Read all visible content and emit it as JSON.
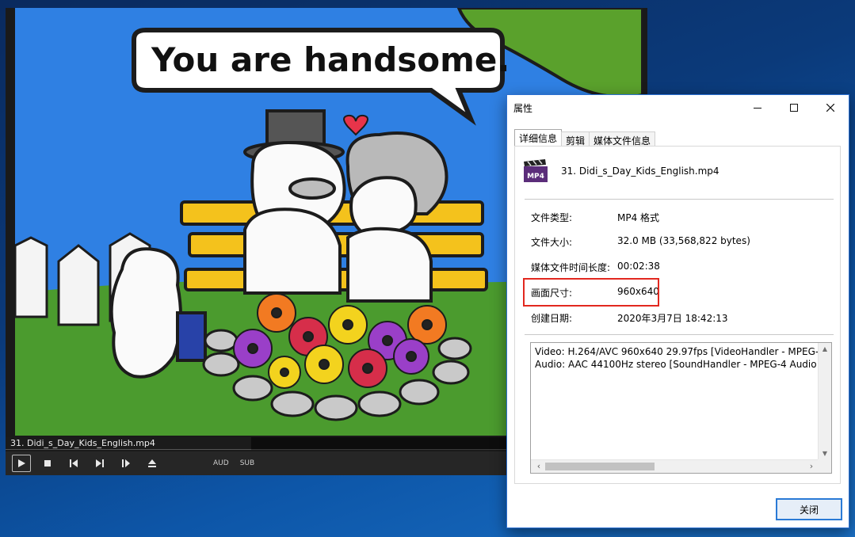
{
  "player": {
    "video_caption": "You are handsome.",
    "file_tab": "31. Didi_s_Day_Kids_English.mp4",
    "controls": {
      "aud_label": "AUD",
      "sub_label": "SUB"
    }
  },
  "dialog": {
    "title": "属性",
    "tabs": [
      "详细信息",
      "剪辑",
      "媒体文件信息"
    ],
    "active_tab": "详细信息",
    "file_icon_label": "MP4",
    "file_name": "31. Didi_s_Day_Kids_English.mp4",
    "properties": [
      {
        "label": "文件类型:",
        "value": "MP4 格式"
      },
      {
        "label": "文件大小:",
        "value": "32.0 MB (33,568,822 bytes)"
      },
      {
        "label": "媒体文件时间长度:",
        "value": "00:02:38"
      },
      {
        "label": "画面尺寸:",
        "value": "960x640"
      },
      {
        "label": "创建日期:",
        "value": "2020年3月7日 18:42:13"
      }
    ],
    "highlighted_row": "画面尺寸:",
    "highlight_color": "#e2281f",
    "stream_info": [
      "Video: H.264/AVC 960x640 29.97fps [VideoHandler - MPEG-",
      "Audio: AAC 44100Hz stereo [SoundHandler - MPEG-4 Audio"
    ],
    "close_button": "关闭"
  },
  "icons": {
    "minimize": "minimize-icon",
    "maximize": "maximize-icon",
    "close": "close-icon",
    "play": "play-icon",
    "stop": "stop-icon",
    "prev": "skip-previous-icon",
    "next": "skip-next-icon",
    "frame_step": "frame-step-icon",
    "eject": "eject-icon"
  }
}
